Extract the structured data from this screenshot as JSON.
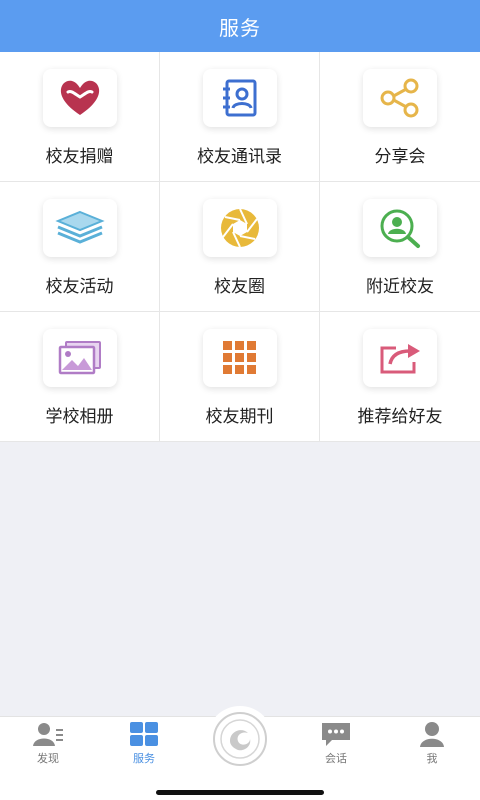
{
  "header": {
    "title": "服务"
  },
  "services": [
    {
      "label": "校友捐赠",
      "icon": "heart-icon",
      "color": "#b8334f"
    },
    {
      "label": "校友通讯录",
      "icon": "contact-book-icon",
      "color": "#3d6fd0"
    },
    {
      "label": "分享会",
      "icon": "share-icon",
      "color": "#e6b54a"
    },
    {
      "label": "校友活动",
      "icon": "layers-icon",
      "color": "#5ab0d8"
    },
    {
      "label": "校友圈",
      "icon": "aperture-icon",
      "color": "#e8b93a"
    },
    {
      "label": "附近校友",
      "icon": "user-search-icon",
      "color": "#4caf50"
    },
    {
      "label": "学校相册",
      "icon": "photo-album-icon",
      "color": "#b07cc6"
    },
    {
      "label": "校友期刊",
      "icon": "grid-icon",
      "color": "#e07a34"
    },
    {
      "label": "推荐给好友",
      "icon": "forward-share-icon",
      "color": "#d95b7a"
    }
  ],
  "tabbar": {
    "tabs": [
      {
        "label": "发现",
        "icon": "discover-icon"
      },
      {
        "label": "服务",
        "icon": "services-icon",
        "active": true
      },
      {
        "label": "会话",
        "icon": "chat-icon"
      },
      {
        "label": "我",
        "icon": "profile-icon"
      }
    ],
    "center_logo": "school-logo-icon"
  }
}
